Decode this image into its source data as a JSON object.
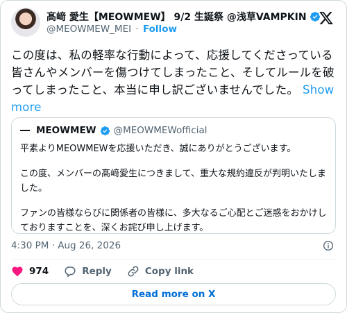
{
  "tweet": {
    "author_name": "髙﨑 愛生【MEOWMEW】 9/2 生誕祭 @浅草VAMPKIN",
    "author_handle": "@MEOWMEW_MEI",
    "separator": "·",
    "follow_label": "Follow",
    "text": "この度は、私の軽率な行動によって、応援してくださっている皆さんやメンバーを傷つけてしまったこと、そしてルールを破ってしまったこと、本当に申し訳ございませんでした。",
    "show_more_label": "Show more",
    "timestamp": "4:30 PM · Aug 26, 2026"
  },
  "quote": {
    "name": "MEOWMEW",
    "handle": "@MEOWMEWofficial",
    "paragraphs": [
      "平素よりMEOWMEWを応援いただき、誠にありがとうございます。",
      "この度、メンバーの髙﨑愛生につきまして、重大な規約違反が判明いたしました。",
      "ファンの皆様ならびに関係者の皆様に、多大なるご心配とご迷惑をおかけしておりますことを、深くお詫び申し上げます。"
    ]
  },
  "actions": {
    "like_count": "974",
    "reply_label": "Reply",
    "copy_link_label": "Copy link"
  },
  "read_more_label": "Read more on X",
  "colors": {
    "accent": "#1d9bf0",
    "like": "#f91880",
    "secondary_text": "#536471",
    "border": "#cfd9de"
  }
}
